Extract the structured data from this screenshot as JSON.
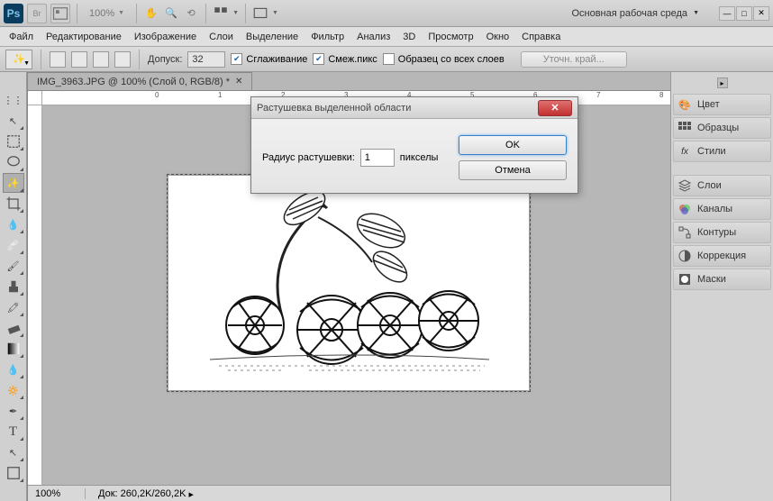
{
  "topbar": {
    "zoom": "100%",
    "workspace": "Основная рабочая среда"
  },
  "menu": [
    "Файл",
    "Редактирование",
    "Изображение",
    "Слои",
    "Выделение",
    "Фильтр",
    "Анализ",
    "3D",
    "Просмотр",
    "Окно",
    "Справка"
  ],
  "options": {
    "tolerance_label": "Допуск:",
    "tolerance_value": "32",
    "antialias": "Сглаживание",
    "contiguous": "Смеж.пикс",
    "all_layers": "Образец со всех слоев",
    "refine": "Уточн. край..."
  },
  "document": {
    "tab_title": "IMG_3963.JPG @ 100% (Слой 0, RGB/8) *"
  },
  "ruler_ticks": [
    "0",
    "1",
    "2",
    "3",
    "4",
    "5",
    "6",
    "7",
    "8"
  ],
  "panels": {
    "groups": [
      [
        "Цвет",
        "Образцы",
        "Стили"
      ],
      [
        "Слои",
        "Каналы",
        "Контуры",
        "Коррекция",
        "Маски"
      ]
    ]
  },
  "status": {
    "zoom": "100%",
    "doc": "Док: 260,2K/260,2K"
  },
  "dialog": {
    "title": "Растушевка выделенной области",
    "label": "Радиус растушевки:",
    "value": "1",
    "unit": "пикселы",
    "ok": "OK",
    "cancel": "Отмена"
  }
}
